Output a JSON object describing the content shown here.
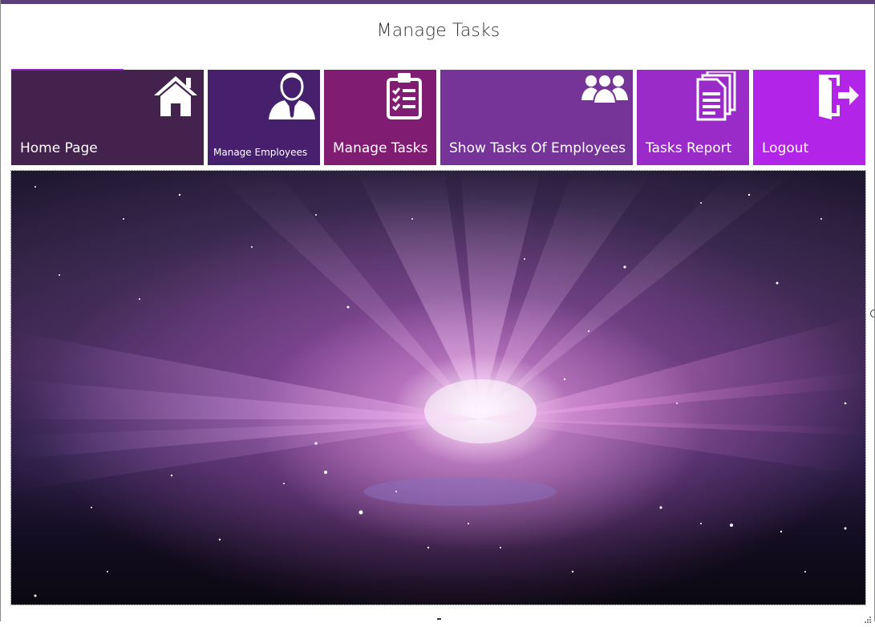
{
  "window": {
    "title": "Manage Tasks"
  },
  "tiles": [
    {
      "label": "Home Page",
      "icon": "home-icon",
      "color": "#43224d"
    },
    {
      "label": "Manage Employees",
      "icon": "employee-icon",
      "color": "#46206d"
    },
    {
      "label": "Manage Tasks",
      "icon": "clipboard-checklist-icon",
      "color": "#811c73"
    },
    {
      "label": "Show Tasks Of Employees",
      "icon": "group-icon",
      "color": "#773498"
    },
    {
      "label": "Tasks Report",
      "icon": "documents-icon",
      "color": "#9b2bc9"
    },
    {
      "label": "Logout",
      "icon": "logout-door-icon",
      "color": "#b324e9"
    }
  ],
  "banner": {
    "image": "aurora-space-wallpaper"
  },
  "colors": {
    "accent": "#8f25c4",
    "top_bar": "#5b3f78"
  }
}
